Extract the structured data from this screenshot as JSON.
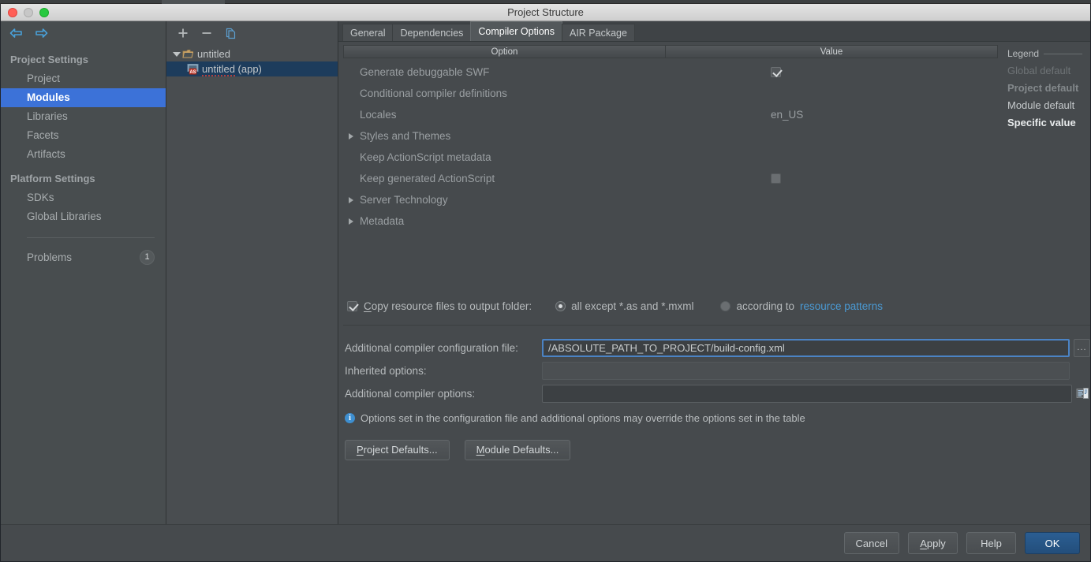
{
  "window": {
    "title": "Project Structure",
    "traffic_lights": [
      "close-red",
      "minimize-grey",
      "zoom-green"
    ]
  },
  "sidebar": {
    "back_icon": "back-arrow-icon",
    "forward_icon": "forward-arrow-icon",
    "groups": [
      {
        "header": "Project Settings",
        "items": [
          {
            "label": "Project",
            "selected": false
          },
          {
            "label": "Modules",
            "selected": true
          },
          {
            "label": "Libraries",
            "selected": false
          },
          {
            "label": "Facets",
            "selected": false
          },
          {
            "label": "Artifacts",
            "selected": false
          }
        ]
      },
      {
        "header": "Platform Settings",
        "items": [
          {
            "label": "SDKs",
            "selected": false
          },
          {
            "label": "Global Libraries",
            "selected": false
          }
        ]
      }
    ],
    "problems": {
      "label": "Problems",
      "count": "1"
    }
  },
  "modules_panel": {
    "toolbar": {
      "add": "+",
      "remove": "−",
      "copy_icon": "copy-icon"
    },
    "tree": [
      {
        "label": "untitled",
        "type": "project",
        "selected": false,
        "expanded": true
      },
      {
        "label": "untitled",
        "suffix": " (app)",
        "type": "module",
        "selected": true
      }
    ]
  },
  "main": {
    "tabs": [
      {
        "label": "General",
        "active": false
      },
      {
        "label": "Dependencies",
        "active": false
      },
      {
        "label": "Compiler Options",
        "active": true
      },
      {
        "label": "AIR Package",
        "active": false
      }
    ],
    "table": {
      "columns": [
        "Option",
        "Value"
      ],
      "rows": [
        {
          "option": "Generate debuggable SWF",
          "value_type": "checkbox",
          "checked": true,
          "expandable": false
        },
        {
          "option": "Conditional compiler definitions",
          "value_type": "none",
          "expandable": false
        },
        {
          "option": "Locales",
          "value_type": "text",
          "value": "en_US",
          "expandable": false
        },
        {
          "option": "Styles and Themes",
          "value_type": "none",
          "expandable": true
        },
        {
          "option": "Keep ActionScript metadata",
          "value_type": "none",
          "expandable": false
        },
        {
          "option": "Keep generated ActionScript",
          "value_type": "checkbox",
          "checked": false,
          "expandable": false
        },
        {
          "option": "Server Technology",
          "value_type": "none",
          "expandable": true
        },
        {
          "option": "Metadata",
          "value_type": "none",
          "expandable": true
        }
      ]
    },
    "legend": {
      "title": "Legend",
      "items": [
        "Global default",
        "Project default",
        "Module default",
        "Specific value"
      ]
    },
    "copy_resources": {
      "checkbox_label": "Copy resource files to output folder:",
      "checked": true,
      "options": [
        {
          "label": "all except *.as and *.mxml",
          "selected": true
        },
        {
          "label": "according to ",
          "link": "resource patterns",
          "selected": false
        }
      ]
    },
    "fields": [
      {
        "label": "Additional compiler configuration file:",
        "value": "/ABSOLUTE_PATH_TO_PROJECT/build-config.xml",
        "focused": true,
        "trailing": "ellipsis-button",
        "trailing_label": "..."
      },
      {
        "label": "Inherited options:",
        "value": "",
        "focused": false,
        "trailing": "none"
      },
      {
        "label": "Additional compiler options:",
        "value": "",
        "focused": false,
        "trailing": "expand-editor-icon"
      }
    ],
    "note": {
      "icon": "info-icon",
      "text": "Options set in the configuration file and additional options may override the options set in the table"
    },
    "defaults_buttons": [
      {
        "label": "Project Defaults...",
        "mnemonic": "P"
      },
      {
        "label": "Module Defaults...",
        "mnemonic": "M"
      }
    ]
  },
  "footer": {
    "buttons": [
      {
        "label": "Cancel",
        "primary": false
      },
      {
        "label": "Apply",
        "primary": false
      },
      {
        "label": "Help",
        "primary": false
      },
      {
        "label": "OK",
        "primary": true
      }
    ]
  },
  "colors": {
    "window_bg": "#464a4d",
    "sidebar_bg": "#484d4f",
    "selection_blue": "#3c72d8",
    "tree_selection": "#1d3c5c",
    "link_blue": "#4a9ad4",
    "focus_border": "#4b83c4",
    "primary_button": "#2b5e92"
  }
}
